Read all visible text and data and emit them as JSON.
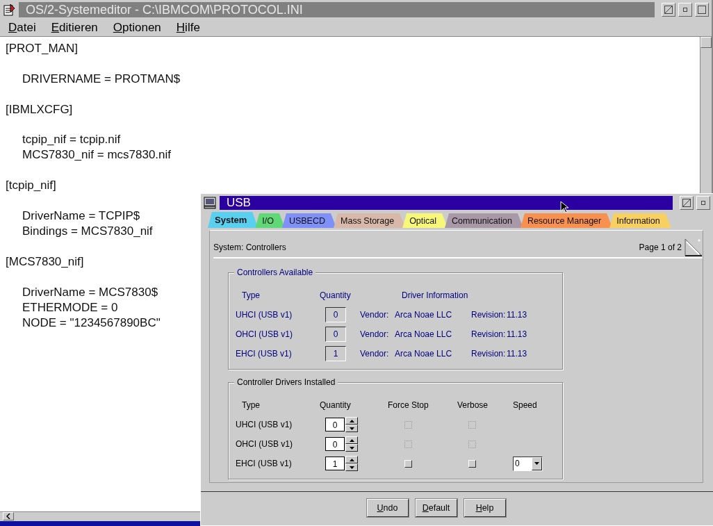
{
  "editor": {
    "title": "OS/2-Systemeditor - C:\\IBMCOM\\PROTOCOL.INI",
    "menu": [
      "Datei",
      "Editieren",
      "Optionen",
      "Hilfe"
    ],
    "sections": [
      {
        "header": "[PROT_MAN]",
        "entries": [
          "DRIVERNAME = PROTMAN$"
        ]
      },
      {
        "header": "[IBMLXCFG]",
        "entries": [
          "tcpip_nif = tcpip.nif",
          "MCS7830_nif = mcs7830.nif"
        ]
      },
      {
        "header": "[tcpip_nif]",
        "entries": [
          "DriverName = TCPIP$",
          "Bindings = MCS7830_nif"
        ]
      },
      {
        "header": "[MCS7830_nif]",
        "entries": [
          "DriverName = MCS7830$",
          "ETHERMODE = 0",
          "NODE = \"1234567890BC\""
        ]
      }
    ]
  },
  "usb": {
    "title": "USB",
    "tabs": [
      {
        "label": "System",
        "color": "#5ad0f0",
        "selected": true
      },
      {
        "label": "I/O",
        "color": "#60d878",
        "selected": false
      },
      {
        "label": "USBECD",
        "color": "#7f90f8",
        "selected": false
      },
      {
        "label": "Mass Storage",
        "color": "#d8b8a8",
        "selected": false
      },
      {
        "label": "Optical",
        "color": "#f8f878",
        "selected": false
      },
      {
        "label": "Communication",
        "color": "#a898a8",
        "selected": false
      },
      {
        "label": "Resource Manager",
        "color": "#f89050",
        "selected": false
      },
      {
        "label": "Information",
        "color": "#f8d060",
        "selected": false
      }
    ],
    "page_title": "System: Controllers",
    "page_number": "Page 1 of 2",
    "available": {
      "title": "Controllers Available",
      "columns": [
        "Type",
        "Quantity",
        "Driver Information"
      ],
      "rows": [
        {
          "type": "UHCI (USB v1)",
          "quantity": "0",
          "vendor_label": "Vendor:",
          "vendor": "Arca Noae LLC",
          "revision_label": "Revision:",
          "revision": "11.13"
        },
        {
          "type": "OHCI (USB v1)",
          "quantity": "0",
          "vendor_label": "Vendor:",
          "vendor": "Arca Noae LLC",
          "revision_label": "Revision:",
          "revision": "11.13"
        },
        {
          "type": "EHCI (USB v1)",
          "quantity": "1",
          "vendor_label": "Vendor:",
          "vendor": "Arca Noae LLC",
          "revision_label": "Revision:",
          "revision": "11.13"
        }
      ]
    },
    "installed": {
      "title": "Controller Drivers Installed",
      "columns": [
        "Type",
        "Quantity",
        "Force Stop",
        "Verbose",
        "Speed"
      ],
      "rows": [
        {
          "type": "UHCI (USB v1)",
          "quantity": "0",
          "force_stop": {
            "checked": false,
            "disabled": true
          },
          "verbose": {
            "checked": false,
            "disabled": true
          }
        },
        {
          "type": "OHCI (USB v1)",
          "quantity": "0",
          "force_stop": {
            "checked": false,
            "disabled": true
          },
          "verbose": {
            "checked": false,
            "disabled": true
          }
        },
        {
          "type": "EHCI (USB v1)",
          "quantity": "1",
          "force_stop": {
            "checked": false,
            "disabled": false
          },
          "verbose": {
            "checked": false,
            "disabled": false
          },
          "speed": "0"
        }
      ]
    },
    "buttons": [
      "Undo",
      "Default",
      "Help"
    ]
  }
}
